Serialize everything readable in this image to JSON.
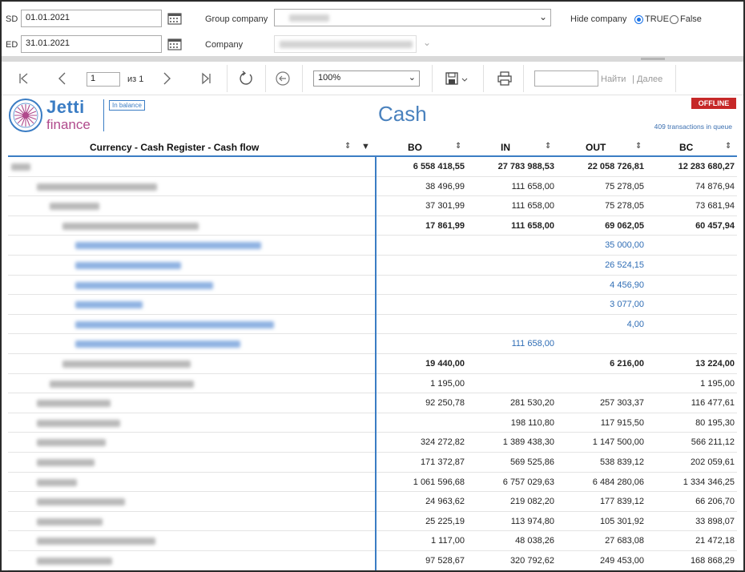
{
  "filters": {
    "sd_label": "SD",
    "sd_value": "01.01.2021",
    "ed_label": "ED",
    "ed_value": "31.01.2021",
    "group_company_label": "Group company",
    "company_label": "Company",
    "hide_company_label": "Hide company",
    "radio_true_label": "TRUE",
    "radio_false_label": "False",
    "radio_selected": "TRUE"
  },
  "toolbar": {
    "page_value": "1",
    "page_of": "из 1",
    "zoom_value": "100%",
    "find_label": "Найти",
    "next_label": "Далее",
    "separator": "|"
  },
  "report": {
    "logo_line1": "Jetti",
    "logo_line2": "finance",
    "badge": "In balance",
    "title": "Cash",
    "status": "OFFLINE",
    "queue_text": "409 transactions in queue"
  },
  "table": {
    "columns": {
      "name": "Currency - Cash Register - Cash flow",
      "bo": "BO",
      "in": "IN",
      "out": "OUT",
      "bc": "BC"
    },
    "rows": [
      {
        "bo": "6 558 418,55",
        "in": "27 783 988,53",
        "out": "22 058 726,81",
        "bc": "12 283 680,27",
        "style": "bold"
      },
      {
        "bo": "38 496,99",
        "in": "111 658,00",
        "out": "75 278,05",
        "bc": "74 876,94",
        "style": ""
      },
      {
        "bo": "37 301,99",
        "in": "111 658,00",
        "out": "75 278,05",
        "bc": "73 681,94",
        "style": ""
      },
      {
        "bo": "17 861,99",
        "in": "111 658,00",
        "out": "69 062,05",
        "bc": "60 457,94",
        "style": "bold"
      },
      {
        "bo": "",
        "in": "",
        "out": "35 000,00",
        "bc": "",
        "style": "blue"
      },
      {
        "bo": "",
        "in": "",
        "out": "26 524,15",
        "bc": "",
        "style": "blue"
      },
      {
        "bo": "",
        "in": "",
        "out": "4 456,90",
        "bc": "",
        "style": "blue"
      },
      {
        "bo": "",
        "in": "",
        "out": "3 077,00",
        "bc": "",
        "style": "blue"
      },
      {
        "bo": "",
        "in": "",
        "out": "4,00",
        "bc": "",
        "style": "blue"
      },
      {
        "bo": "",
        "in": "111 658,00",
        "out": "",
        "bc": "",
        "style": "blue"
      },
      {
        "bo": "19 440,00",
        "in": "",
        "out": "6 216,00",
        "bc": "13 224,00",
        "style": "bold"
      },
      {
        "bo": "1 195,00",
        "in": "",
        "out": "",
        "bc": "1 195,00",
        "style": ""
      },
      {
        "bo": "92 250,78",
        "in": "281 530,20",
        "out": "257 303,37",
        "bc": "116 477,61",
        "style": ""
      },
      {
        "bo": "",
        "in": "198 110,80",
        "out": "117 915,50",
        "bc": "80 195,30",
        "style": ""
      },
      {
        "bo": "324 272,82",
        "in": "1 389 438,30",
        "out": "1 147 500,00",
        "bc": "566 211,12",
        "style": ""
      },
      {
        "bo": "171 372,87",
        "in": "569 525,86",
        "out": "538 839,12",
        "bc": "202 059,61",
        "style": ""
      },
      {
        "bo": "1 061 596,68",
        "in": "6 757 029,63",
        "out": "6 484 280,06",
        "bc": "1 334 346,25",
        "style": ""
      },
      {
        "bo": "24 963,62",
        "in": "219 082,20",
        "out": "177 839,12",
        "bc": "66 206,70",
        "style": ""
      },
      {
        "bo": "25 225,19",
        "in": "113 974,80",
        "out": "105 301,92",
        "bc": "33 898,07",
        "style": ""
      },
      {
        "bo": "1 117,00",
        "in": "48 038,26",
        "out": "27 683,08",
        "bc": "21 472,18",
        "style": ""
      },
      {
        "bo": "97 528,67",
        "in": "320 792,62",
        "out": "249 453,00",
        "bc": "168 868,29",
        "style": ""
      }
    ]
  }
}
